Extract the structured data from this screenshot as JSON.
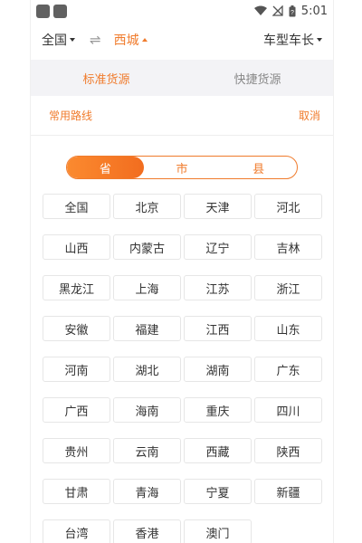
{
  "status_bar": {
    "time": "5:01"
  },
  "header": {
    "origin": "全国",
    "swap_icon": "⇌",
    "destination": "西城",
    "vehicle": "车型车长"
  },
  "tabs": [
    {
      "label": "标准货源",
      "active": true
    },
    {
      "label": "快捷货源",
      "active": false
    }
  ],
  "routes": {
    "common_routes": "常用路线",
    "cancel": "取消"
  },
  "segment": [
    {
      "label": "省",
      "active": true
    },
    {
      "label": "市",
      "active": false
    },
    {
      "label": "县",
      "active": false
    }
  ],
  "regions": [
    "全国",
    "北京",
    "天津",
    "河北",
    "山西",
    "内蒙古",
    "辽宁",
    "吉林",
    "黑龙江",
    "上海",
    "江苏",
    "浙江",
    "安徽",
    "福建",
    "江西",
    "山东",
    "河南",
    "湖北",
    "湖南",
    "广东",
    "广西",
    "海南",
    "重庆",
    "四川",
    "贵州",
    "云南",
    "西藏",
    "陕西",
    "甘肃",
    "青海",
    "宁夏",
    "新疆",
    "台湾",
    "香港",
    "澳门"
  ],
  "colors": {
    "accent": "#f07b2c",
    "tab_bg": "#f3f3f6"
  }
}
